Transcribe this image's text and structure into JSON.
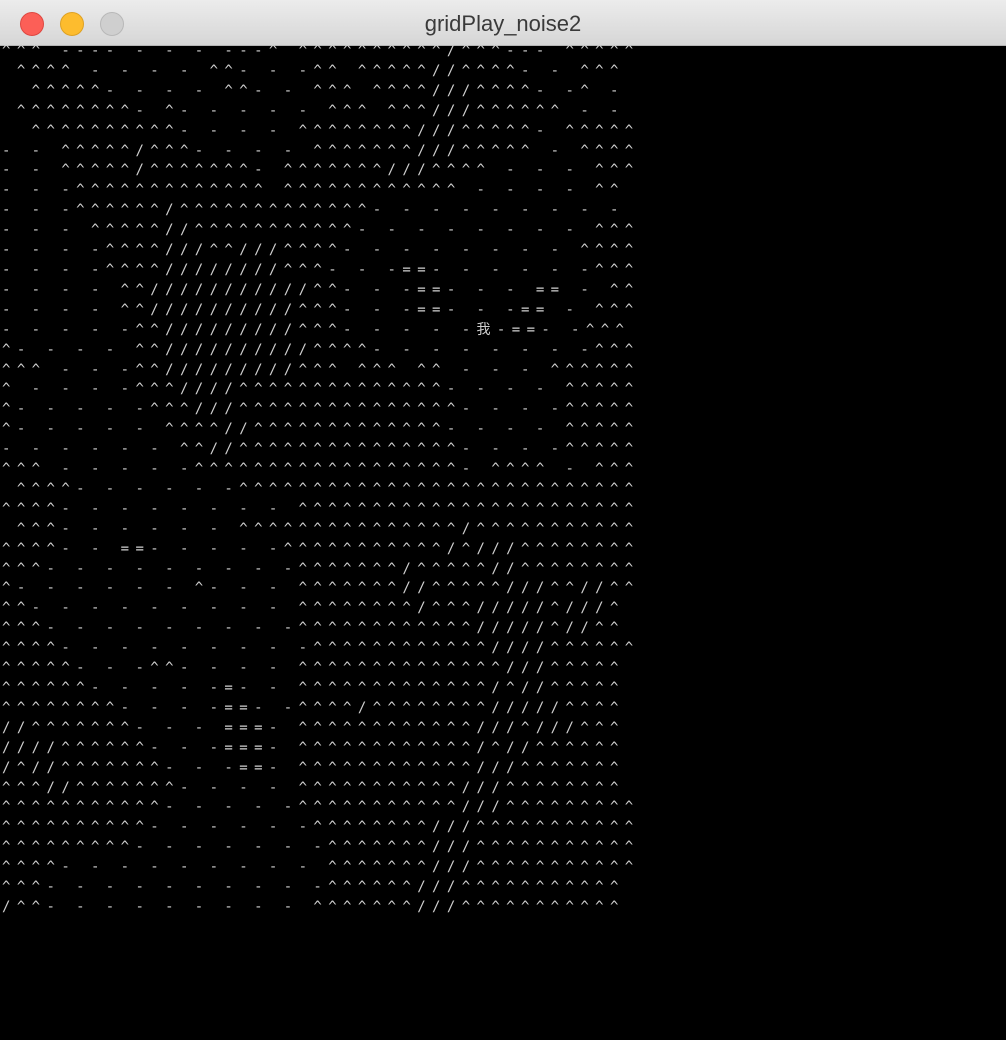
{
  "window": {
    "title": "gridPlay_noise2"
  },
  "canvas": {
    "glyph": "我",
    "grid_rows": [
      "^^^ ---- - - - ---^ ^^^^^^^^^^/^^^--- ^^^^^",
      " ^^^^ - - - - ^^- - -^^ ^^^^^//^^^^- - ^^^ ",
      "  ^^^^^- - - - ^^- - ^^^ ^^^^///^^^^- -^ - ",
      " ^^^^^^^^- ^- - - - - ^^^ ^^^///^^^^^^ - - ",
      "  ^^^^^^^^^^- - - - ^^^^^^^^///^^^^^- ^^^^^",
      "- - ^^^^^/^^^- - - - ^^^^^^^///^^^^^ - ^^^^",
      "- - ^^^^^/^^^^^^^- ^^^^^^^///^^^^ - - - ^^^",
      "- - -^^^^^^^^^^^^^ ^^^^^^^^^^^^ - - - - ^^ ",
      "- - -^^^^^^/^^^^^^^^^^^^^- - - - - - - - - ",
      "- - - ^^^^^//^^^^^^^^^^^- - - - - - - - ^^^",
      "- - - -^^^^///^^///^^^^- - - - - - - - ^^^^",
      "- - - -^^^^////////^^^- - -==- - - - - -^^^",
      "- - - - ^^///////////^^- - -==- - - == - ^^",
      "- - - - ^^//////////^^^- - -==- - -== - ^^^",
      "- - - - -^^/////////^^^- - - - -我-==- -^^^",
      "^- - - - ^^//////////^^^^- - - - - - - -^^^",
      "^^^ - - -^^/////////^^^ ^^^ ^^ - - - ^^^^^^",
      "^ - - - -^^^////^^^^^^^^^^^^^^- - - - ^^^^^",
      "^- - - - -^^^///^^^^^^^^^^^^^^^- - - -^^^^^",
      "^- - - - - ^^^^//^^^^^^^^^^^^^- - - - ^^^^^",
      "- - - - - - ^^//^^^^^^^^^^^^^^^- - - -^^^^^",
      "^^^ - - - - -^^^^^^^^^^^^^^^^^^- ^^^^ - ^^^",
      " ^^^^- - - - - -^^^^^^^^^^^^^^^^^^^^^^^^^^^",
      "^^^^- - - - - - - - ^^^^^^^^^^^^^^^^^^^^^^^",
      " ^^^- - - - - - ^^^^^^^^^^^^^^^/^^^^^^^^^^^",
      "^^^^- - ==- - - - -^^^^^^^^^^^/^///^^^^^^^^",
      "^^^- - - - - - - - -^^^^^^^/^^^^^//^^^^^^^^",
      "^- - - - - - ^- - - ^^^^^^^//^^^^^///^^//^^",
      "^^- - - - - - - - - ^^^^^^^^/^^^/////^///^ ",
      "^^^- - - - - - - - -^^^^^^^^^^^^/////^//^^ ",
      "^^^^- - - - - - - - -^^^^^^^^^^^^////^^^^^^",
      "^^^^^- - -^^- - - - ^^^^^^^^^^^^^^///^^^^^ ",
      "^^^^^^- - - - -=- - ^^^^^^^^^^^^^/^//^^^^^ ",
      "^^^^^^^^- - - -==- -^^^^/^^^^^^^^/////^^^^ ",
      "//^^^^^^^- - - ===- ^^^^^^^^^^^^///^///^^^ ",
      "////^^^^^^- - -===- ^^^^^^^^^^^^/^//^^^^^^ ",
      "/^//^^^^^^^- - -==- ^^^^^^^^^^^^///^^^^^^^ ",
      "^^^//^^^^^^^- - - - ^^^^^^^^^^^///^^^^^^^^ ",
      "^^^^^^^^^^^- - - - -^^^^^^^^^^^///^^^^^^^^^",
      "^^^^^^^^^^- - - - - -^^^^^^^^///^^^^^^^^^^^",
      "^^^^^^^^^- - - - - - -^^^^^^^///^^^^^^^^^^^",
      "^^^^- - - - - - - - - ^^^^^^^///^^^^^^^^^^^",
      "^^^- - - - - - - - - -^^^^^^///^^^^^^^^^^^ ",
      "/^^- - - - - - - - - ^^^^^^^///^^^^^^^^^^^ "
    ]
  }
}
